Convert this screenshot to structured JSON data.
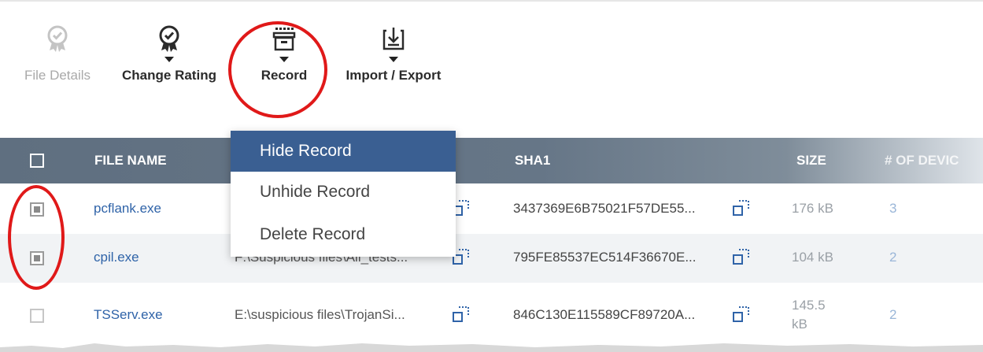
{
  "toolbar": {
    "file_details": {
      "label": "File Details",
      "icon": "award-badge-icon",
      "disabled": true
    },
    "change_rating": {
      "label": "Change Rating",
      "icon": "award-badge-icon"
    },
    "record": {
      "label": "Record",
      "icon": "archive-box-icon"
    },
    "import_export": {
      "label": "Import / Export",
      "icon": "download-tray-icon"
    }
  },
  "record_menu": {
    "items": [
      {
        "label": "Hide Record",
        "active": true
      },
      {
        "label": "Unhide Record",
        "active": false
      },
      {
        "label": "Delete Record",
        "active": false
      }
    ]
  },
  "table": {
    "columns": [
      "FILE NAME",
      "SHA1",
      "SIZE",
      "# OF DEVIC"
    ],
    "rows": [
      {
        "checked": true,
        "file_name": "pcflank.exe",
        "path": "",
        "sha1": "3437369E6B75021F57DE55...",
        "size": "176 kB",
        "devices": "3"
      },
      {
        "checked": true,
        "file_name": "cpil.exe",
        "path": "F:\\Suspicious files\\All_tests...",
        "sha1": "795FE85537EC514F36670E...",
        "size": "104 kB",
        "devices": "2"
      },
      {
        "checked": false,
        "file_name": "TSServ.exe",
        "path": "E:\\suspicious files\\TrojanSi...",
        "sha1": "846C130E115589CF89720A...",
        "size": "145.5 kB",
        "devices": "2"
      }
    ]
  },
  "colors": {
    "header_bg": "#5f6f80",
    "link": "#2f63a8",
    "menu_active_bg": "#3a5f92",
    "annotation": "#e01919",
    "copy_icon": "#2f63a8"
  }
}
